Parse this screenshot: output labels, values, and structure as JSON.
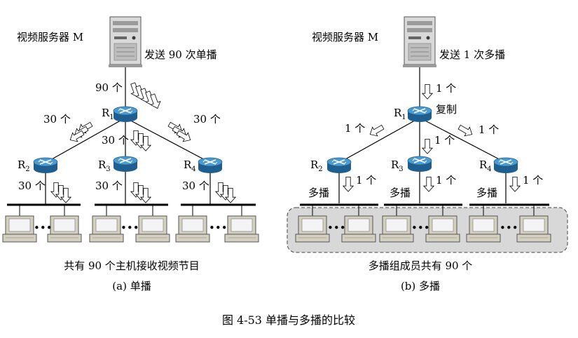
{
  "unicast": {
    "server_label": "视频服务器 M",
    "server_action": "发送 90 次单播",
    "link_count_top": "90 个",
    "link_count_left": "30 个",
    "link_count_mid": "30 个",
    "link_count_right": "30 个",
    "lan_count_1": "30 个",
    "lan_count_2": "30 个",
    "lan_count_3": "30 个",
    "summary": "共有 90 个主机接收视频节目",
    "caption": "(a) 单播"
  },
  "multicast": {
    "server_label": "视频服务器 M",
    "server_action": "发送 1 次多播",
    "link_count_top": "1 个",
    "copy_label": "复制",
    "link_count_left": "1 个",
    "link_count_mid": "1 个",
    "link_count_right": "1 个",
    "lan_count_1": "1 个",
    "lan_count_2": "1 个",
    "lan_count_3": "1 个",
    "lan_label_1": "多播",
    "lan_label_2": "多播",
    "lan_label_3": "多播",
    "summary": "多播组成员共有 90 个",
    "caption": "(b) 多播"
  },
  "routers": {
    "r": "R",
    "s1": "1",
    "s2": "2",
    "s3": "3",
    "s4": "4"
  },
  "ellipsis": "•••",
  "figure_caption": "图 4-53 单播与多播的比较"
}
